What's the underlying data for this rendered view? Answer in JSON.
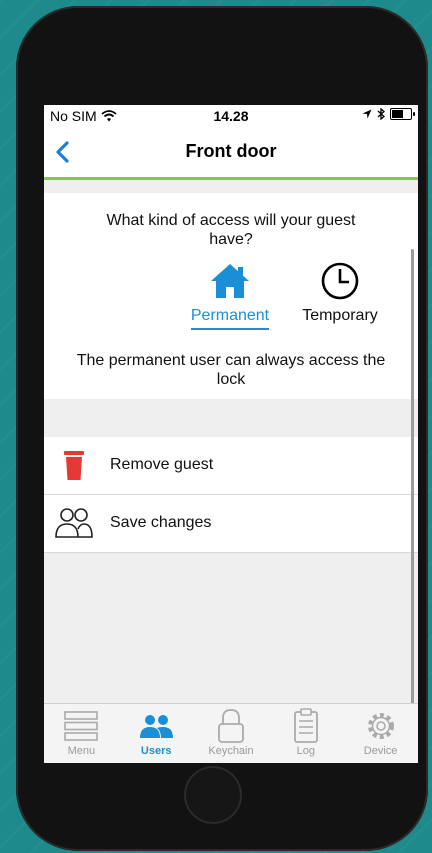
{
  "status_bar": {
    "carrier": "No SIM",
    "time": "14.28",
    "wifi_icon": "wifi-icon",
    "location_icon": "location-arrow-icon",
    "bluetooth_icon": "bluetooth-icon",
    "battery_icon": "battery-icon"
  },
  "nav": {
    "title": "Front door",
    "back_icon": "chevron-left-icon",
    "accent_color": "#8dc63f"
  },
  "access": {
    "question": "What kind of access will your guest have?",
    "options": [
      {
        "label": "Permanent",
        "icon": "home-icon",
        "selected": true
      },
      {
        "label": "Temporary",
        "icon": "clock-icon",
        "selected": false
      }
    ],
    "description": "The permanent user can always access the lock",
    "selected_color": "#1a8fd8"
  },
  "actions": [
    {
      "label": "Remove guest",
      "icon": "trash-icon",
      "icon_color": "#e53935"
    },
    {
      "label": "Save changes",
      "icon": "users-icon"
    }
  ],
  "tabs": [
    {
      "label": "Menu",
      "icon": "menu-icon",
      "active": false
    },
    {
      "label": "Users",
      "icon": "users-icon",
      "active": true
    },
    {
      "label": "Keychain",
      "icon": "lock-icon",
      "active": false
    },
    {
      "label": "Log",
      "icon": "clipboard-icon",
      "active": false
    },
    {
      "label": "Device",
      "icon": "gear-icon",
      "active": false
    }
  ]
}
